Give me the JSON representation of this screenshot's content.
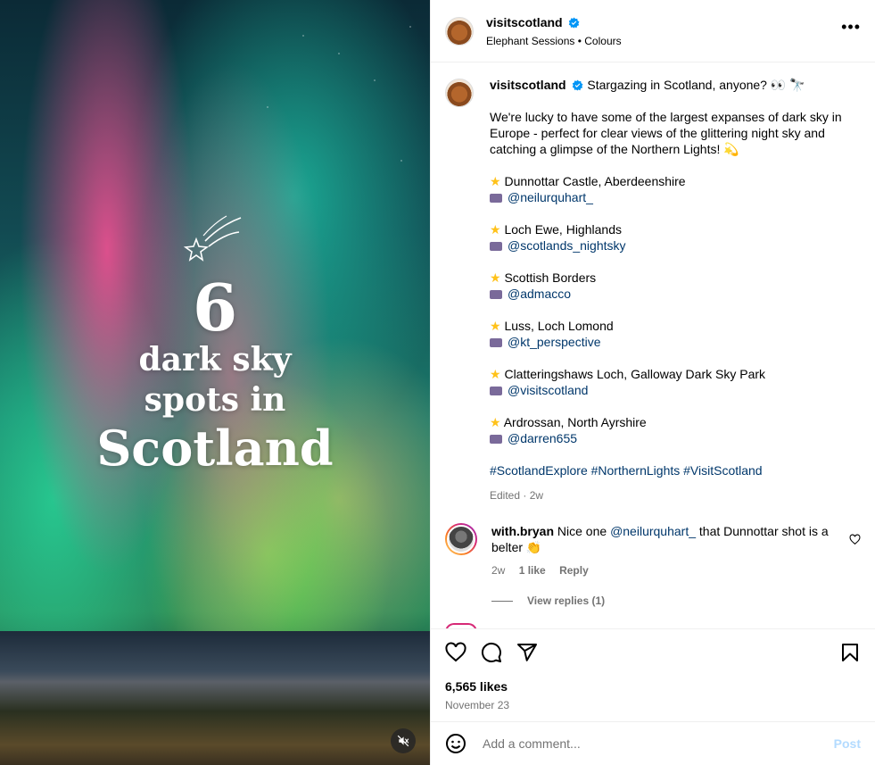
{
  "media": {
    "headline_number": "6",
    "headline_line1": "dark sky",
    "headline_line2": "spots in",
    "headline_line3": "Scotland"
  },
  "header": {
    "username": "visitscotland",
    "audio": "Elephant Sessions • Colours"
  },
  "caption": {
    "username": "visitscotland",
    "intro": "Stargazing in Scotland, anyone? 👀 🔭",
    "body": "We're lucky to have some of the largest expanses of dark sky in Europe - perfect for clear views of the glittering night sky and catching a glimpse of the Northern Lights! 💫",
    "spots": [
      {
        "place": "Dunnottar Castle, Aberdeenshire",
        "credit": "@neilurquhart_"
      },
      {
        "place": "Loch Ewe, Highlands",
        "credit": "@scotlands_nightsky"
      },
      {
        "place": "Scottish Borders",
        "credit": "@admacco"
      },
      {
        "place": "Luss, Loch Lomond",
        "credit": "@kt_perspective"
      },
      {
        "place": "Clatteringshaws Loch, Galloway Dark Sky Park",
        "credit": "@visitscotland"
      },
      {
        "place": "Ardrossan, North Ayrshire",
        "credit": "@darren655"
      }
    ],
    "hashtags": "#ScotlandExplore #NorthernLights #VisitScotland",
    "edited": "Edited · 2w"
  },
  "comment": {
    "username": "with.bryan",
    "text_before": "Nice one ",
    "mention": "@neilurquhart_",
    "text_after": " that Dunnottar shot is a belter 👏",
    "time": "2w",
    "likes": "1 like",
    "reply": "Reply",
    "view_replies": "View replies (1)"
  },
  "footer": {
    "likes": "6,565 likes",
    "date": "November 23",
    "comment_placeholder": "Add a comment...",
    "post_label": "Post"
  },
  "colors": {
    "link": "#00376b",
    "verified": "#0095f6",
    "muted": "#737373",
    "post_disabled": "#b3dbff"
  },
  "icons": [
    "verified-badge-icon",
    "more-options-icon",
    "heart-icon",
    "comment-icon",
    "share-icon",
    "bookmark-icon",
    "emoji-icon",
    "mute-icon",
    "star-icon",
    "camera-icon"
  ]
}
